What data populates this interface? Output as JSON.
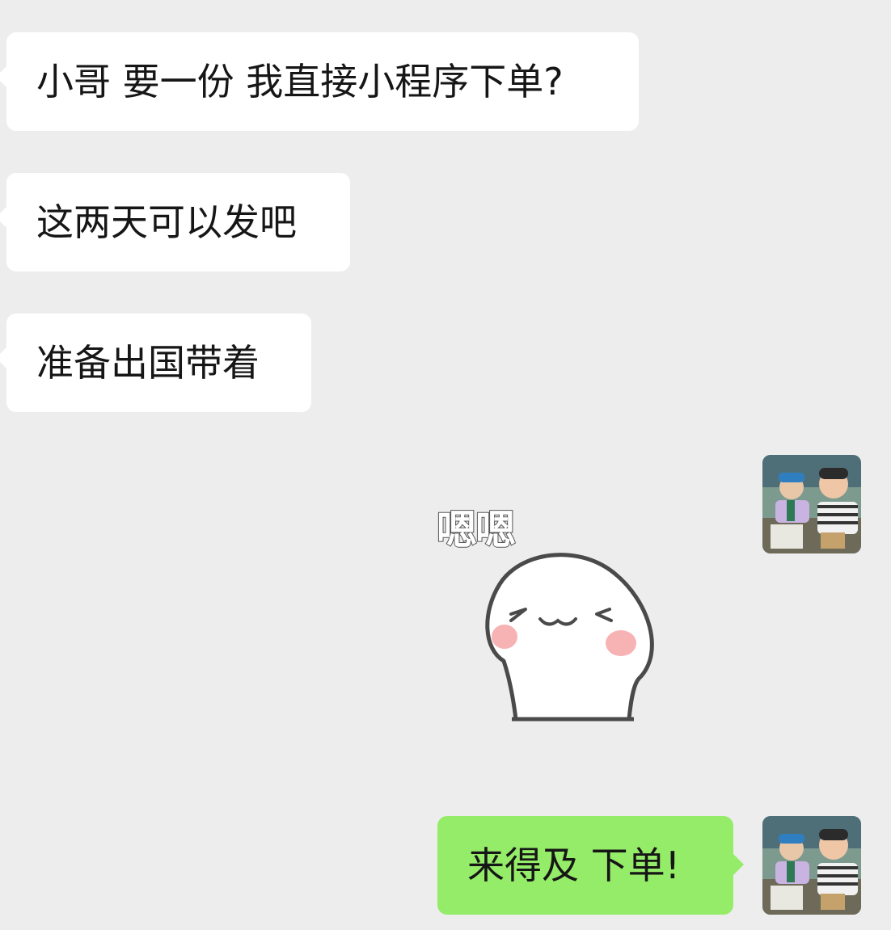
{
  "chat": {
    "messages": [
      {
        "direction": "incoming",
        "text": "小哥 要一份 我直接小程序下单?"
      },
      {
        "direction": "incoming",
        "text": "这两天可以发吧"
      },
      {
        "direction": "incoming",
        "text": "准备出国带着"
      },
      {
        "direction": "outgoing",
        "type": "sticker",
        "sticker_text": "嗯嗯",
        "icon": "smiling-blob-sticker"
      },
      {
        "direction": "outgoing",
        "text": "来得及 下单!"
      }
    ]
  },
  "colors": {
    "background": "#ededed",
    "incoming_bubble": "#ffffff",
    "outgoing_bubble": "#95ec69",
    "text": "#161616"
  }
}
